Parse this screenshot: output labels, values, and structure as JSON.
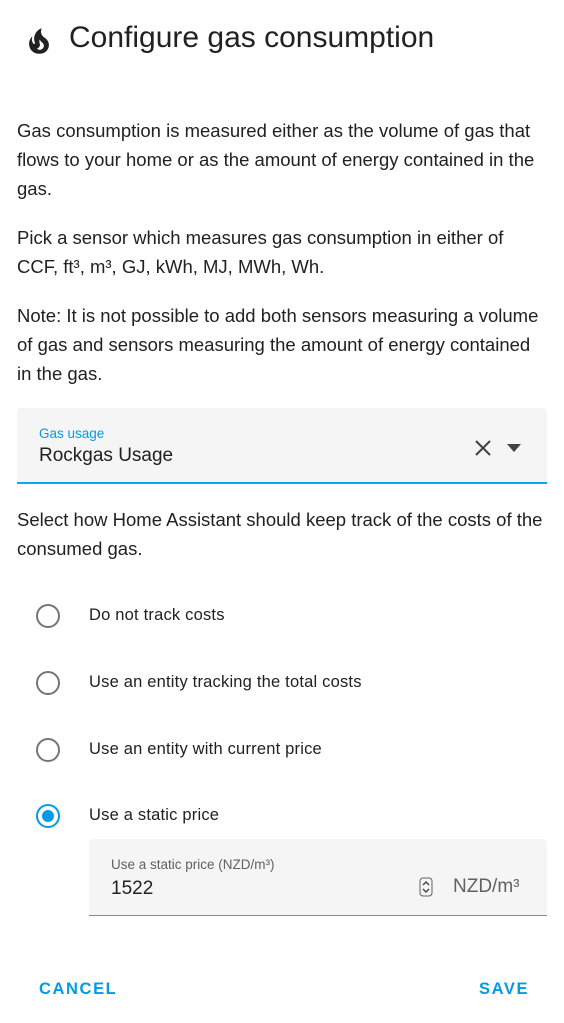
{
  "header": {
    "icon": "fire-icon",
    "title": "Configure gas consumption"
  },
  "intro": {
    "paragraph_1": "Gas consumption is measured either as the volume of gas that flows to your home or as the amount of energy contained in the gas.",
    "paragraph_2": "Pick a sensor which measures gas consumption in either of CCF, ft³, m³, GJ, kWh, MJ, MWh, Wh.",
    "paragraph_3": "Note: It is not possible to add both sensors measuring a volume of gas and sensors measuring the amount of energy contained in the gas."
  },
  "gas_usage": {
    "label": "Gas usage",
    "value": "Rockgas Usage",
    "accent_color": "#03a9f4"
  },
  "cost_tracking": {
    "prompt": "Select how Home Assistant should keep track of the costs of the consumed gas.",
    "options": [
      {
        "label": "Do not track costs",
        "selected": false
      },
      {
        "label": "Use an entity tracking the total costs",
        "selected": false
      },
      {
        "label": "Use an entity with current price",
        "selected": false
      },
      {
        "label": "Use a static price",
        "selected": true
      }
    ]
  },
  "static_price": {
    "label": "Use a static price (NZD/m³)",
    "value": "1522",
    "suffix": "NZD/m³"
  },
  "actions": {
    "cancel_label": "CANCEL",
    "save_label": "SAVE",
    "color": "#039be5"
  }
}
